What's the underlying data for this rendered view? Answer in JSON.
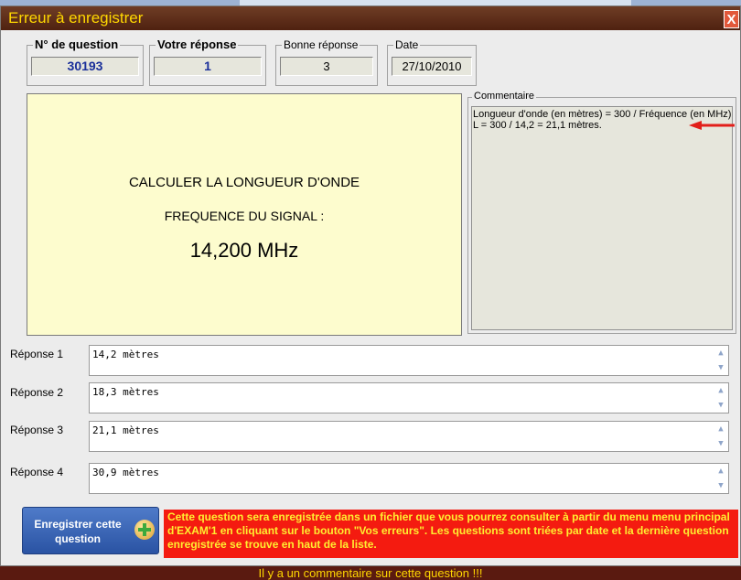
{
  "title": "Erreur à enregistrer",
  "close_label": "X",
  "fields": {
    "question_number": {
      "label": "N° de question",
      "value": "30193"
    },
    "your_answer": {
      "label": "Votre réponse",
      "value": "1"
    },
    "correct_answer": {
      "label": "Bonne réponse",
      "value": "3"
    },
    "date": {
      "label": "Date",
      "value": "27/10/2010"
    }
  },
  "question": {
    "line1": "CALCULER LA LONGUEUR D'ONDE",
    "line2": "FREQUENCE DU SIGNAL :",
    "line3": "14,200 MHz"
  },
  "comment": {
    "label": "Commentaire",
    "line1": "Longueur d'onde (en mètres) = 300 / Fréquence (en MHz)",
    "line2": "L = 300 / 14,2 = 21,1 mètres."
  },
  "responses": [
    {
      "label": "Réponse 1",
      "value": "14,2 mètres"
    },
    {
      "label": "Réponse 2",
      "value": "18,3 mètres"
    },
    {
      "label": "Réponse 3",
      "value": "21,1 mètres"
    },
    {
      "label": "Réponse 4",
      "value": "30,9 mètres"
    }
  ],
  "save_button": {
    "line1": "Enregistrer cette",
    "line2": "question",
    "icon": "add-icon"
  },
  "notice": "Cette question sera enregistrée dans un fichier que vous pourrez consulter à partir du menu menu principal d'EXAM'1 en cliquant sur le bouton \"Vos erreurs\". Les questions sont triées par date et la dernière question enregistrée se trouve en haut de la liste.",
  "status": "Il y a un commentaire sur cette question !!!",
  "colors": {
    "title_text": "#ffd800",
    "notice_bg": "#f41b10",
    "notice_text": "#ffee30",
    "question_bg": "#fdfcce",
    "answer_blue": "#1a2f9a"
  }
}
